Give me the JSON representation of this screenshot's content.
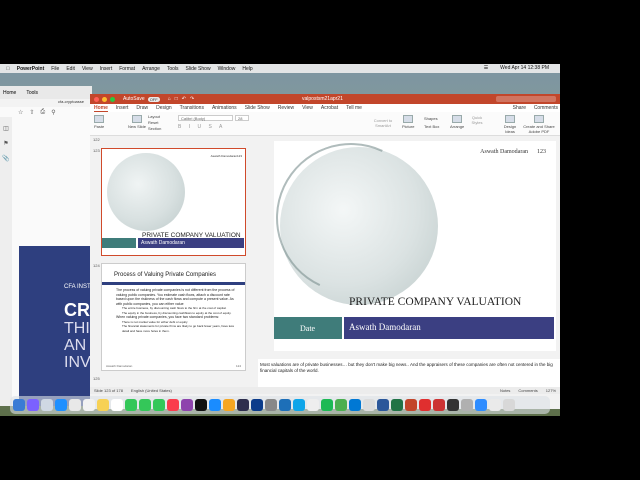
{
  "menubar": {
    "items": [
      "PowerPoint",
      "File",
      "Edit",
      "View",
      "Insert",
      "Format",
      "Arrange",
      "Tools",
      "Slide Show",
      "Window",
      "Help"
    ],
    "clock": "Wed Apr 14  12:38 PM"
  },
  "acrobat": {
    "tabs": [
      "Home",
      "Tools"
    ],
    "doc_tab": "cfa-cryptoasse",
    "doc_lines": [
      "CFA INST",
      "CR",
      "THI",
      "AN",
      "INV"
    ]
  },
  "powerpoint": {
    "autosave": "AutoSave",
    "autosave_state": "OFF",
    "title": "valpostsm21apr21",
    "tell_me": "Tell me",
    "ribbon_tabs": [
      "Home",
      "Insert",
      "Draw",
      "Design",
      "Transitions",
      "Animations",
      "Slide Show",
      "Review",
      "View",
      "Acrobat"
    ],
    "share": "Share",
    "comments": "Comments",
    "ribbon": {
      "paste": "Paste",
      "new_slide": "New Slide",
      "layout": "Layout",
      "reset": "Reset",
      "section": "Section",
      "font": "Calibri (Body)",
      "size": "28",
      "convert": "Convert to SmartArt",
      "picture": "Picture",
      "shapes": "Shapes",
      "text_box": "Text Box",
      "arrange": "Arrange",
      "quick_styles": "Quick Styles",
      "design_ideas": "Design Ideas",
      "create_share": "Create and Share Adobe PDF"
    },
    "thumbs": {
      "num_1": "122",
      "num_2": "123",
      "num_3": "124",
      "num_4": "125",
      "slide1": {
        "author": "Aswath Damodaran",
        "page": "123",
        "title": "PRIVATE COMPANY VALUATION",
        "name": "Aswath Damodaran"
      },
      "slide2": {
        "title": "Process of Valuing Private Companies",
        "bullets": [
          "The process of valuing private companies is not different from the process of valuing public companies. You estimate cash flows, attach a discount rate based upon the riskiness of the cash flows and compute a present value. As with public companies, you can either value",
          "The entire business, by discounting cash flows to the firm at the cost of capital.",
          "The equity in the business, by discounting cashflows to equity at the cost of equity.",
          "When valuing private companies, you face two standard problems:",
          "There is not market value for either debt or equity",
          "The financial statements for private firms are likely to go back fewer years, have less detail and have more holes in them."
        ],
        "footer": "Aswath Damodaran",
        "page": "124"
      }
    },
    "slide": {
      "author": "Aswath Damodaran",
      "page": "123",
      "title": "PRIVATE COMPANY VALUATION",
      "date_label": "Date",
      "name": "Aswath Damodaran"
    },
    "notes": "Most valuations are of private businesses… but they don't make big news.. And the appraisers of these companies are often not centered in the big financial capitals of the world.",
    "status": {
      "slide_pos": "Slide 123 of 178",
      "language": "English (United States)",
      "notes_btn": "Notes",
      "comments_btn": "Comments",
      "zoom": "127%"
    }
  },
  "colors": {
    "ppt_accent": "#c2462b",
    "slide_teal": "#3f7c7a",
    "slide_navy": "#3b3f82"
  }
}
